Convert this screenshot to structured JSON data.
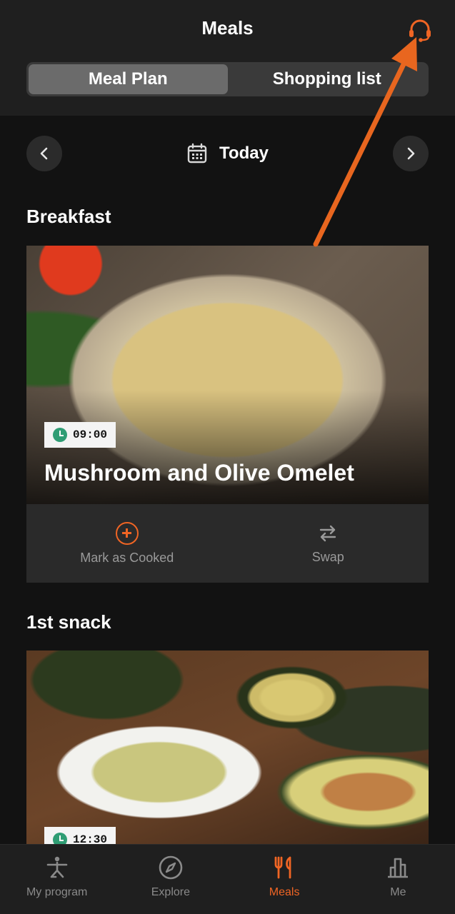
{
  "header": {
    "title": "Meals",
    "support_icon": "headset-icon"
  },
  "segmented": {
    "items": [
      {
        "label": "Meal Plan",
        "active": true
      },
      {
        "label": "Shopping list",
        "active": false
      }
    ]
  },
  "date_nav": {
    "label": "Today",
    "prev_icon": "chevron-left-icon",
    "next_icon": "chevron-right-icon",
    "calendar_icon": "calendar-icon"
  },
  "meals": [
    {
      "section": "Breakfast",
      "time": "09:00",
      "name": "Mushroom and Olive Omelet",
      "actions": {
        "cooked": "Mark as Cooked",
        "swap": "Swap"
      }
    },
    {
      "section": "1st snack",
      "time": "12:30"
    }
  ],
  "tabbar": {
    "items": [
      {
        "label": "My program",
        "icon": "yoga-pose-icon",
        "active": false
      },
      {
        "label": "Explore",
        "icon": "compass-icon",
        "active": false
      },
      {
        "label": "Meals",
        "icon": "fork-knife-icon",
        "active": true
      },
      {
        "label": "Me",
        "icon": "bar-chart-icon",
        "active": false
      }
    ]
  },
  "colors": {
    "accent": "#f06524",
    "background": "#121212",
    "header": "#1f1f1f",
    "clock": "#2f9d74"
  }
}
